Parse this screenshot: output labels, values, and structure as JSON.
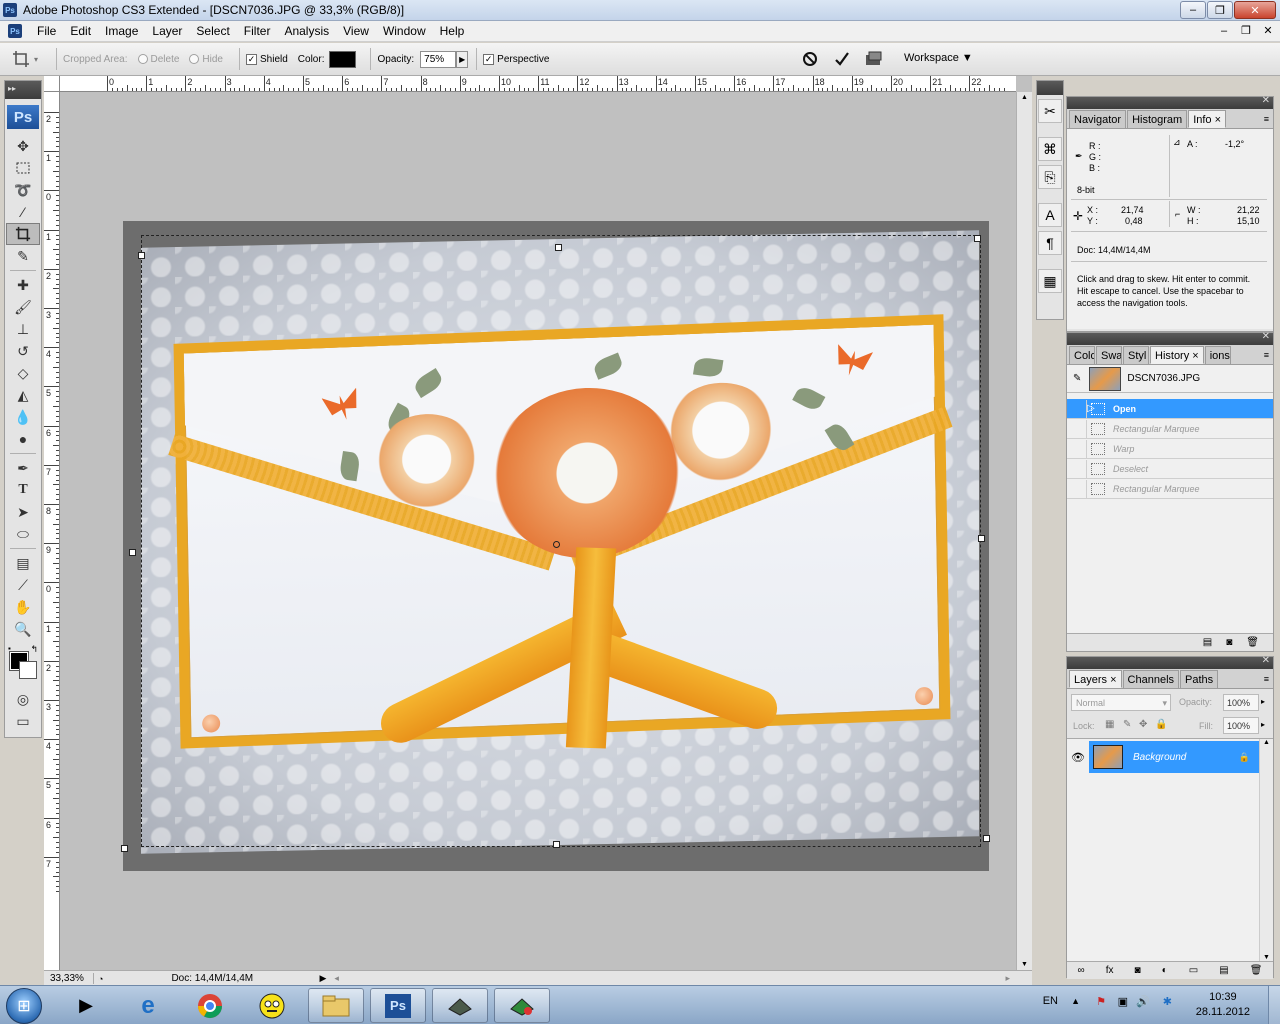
{
  "window": {
    "title": "Adobe Photoshop CS3 Extended - [DSCN7036.JPG @ 33,3% (RGB/8)]",
    "app_icon": "Ps",
    "minimize": "–",
    "restore": "❐",
    "close": "✕"
  },
  "menu": {
    "items": [
      "File",
      "Edit",
      "Image",
      "Layer",
      "Select",
      "Filter",
      "Analysis",
      "View",
      "Window",
      "Help"
    ]
  },
  "options": {
    "cropped_area_label": "Cropped Area:",
    "delete_label": "Delete",
    "hide_label": "Hide",
    "shield_label": "Shield",
    "shield_checked": "✓",
    "color_label": "Color:",
    "shield_color": "#000000",
    "opacity_label": "Opacity:",
    "opacity_value": "75%",
    "perspective_label": "Perspective",
    "perspective_checked": "✓",
    "workspace_label": "Workspace"
  },
  "toolbox": {
    "logo": "Ps"
  },
  "rulers": {
    "top": [
      "0",
      "1",
      "2",
      "3",
      "4",
      "5",
      "6",
      "7",
      "8",
      "9",
      "10",
      "11",
      "12",
      "13",
      "14",
      "15",
      "16",
      "17",
      "18",
      "19",
      "20",
      "21",
      "22"
    ],
    "left": [
      "2",
      "1",
      "0",
      "1",
      "2",
      "3",
      "4",
      "5",
      "6",
      "7",
      "8",
      "9",
      "0",
      "1",
      "2",
      "3",
      "4",
      "5",
      "6",
      "7"
    ]
  },
  "status": {
    "zoom": "33,33%",
    "doc": "Doc: 14,4M/14,4M"
  },
  "info_panel": {
    "tabs": [
      "Navigator",
      "Histogram",
      "Info"
    ],
    "active_tab": "Info",
    "r": "R :",
    "g": "G :",
    "b": "B :",
    "angle_label": "A :",
    "angle_value": "-1,2°",
    "bitdepth": "8-bit",
    "x_label": "X :",
    "x_value": "21,74",
    "y_label": "Y :",
    "y_value": "0,48",
    "w_label": "W :",
    "w_value": "21,22",
    "h_label": "H :",
    "h_value": "15,10",
    "doc": "Doc: 14,4M/14,4M",
    "hint": "Click and drag to skew. Hit enter to commit. Hit escape to cancel. Use the spacebar to access the navigation tools."
  },
  "history_panel": {
    "tabs": [
      "Colo",
      "Swa",
      "Styl",
      "History",
      "ions"
    ],
    "snapshot": "DSCN7036.JPG",
    "steps": [
      {
        "label": "Open",
        "state": "selected"
      },
      {
        "label": "Rectangular Marquee",
        "state": "disabled"
      },
      {
        "label": "Warp",
        "state": "disabled"
      },
      {
        "label": "Deselect",
        "state": "disabled"
      },
      {
        "label": "Rectangular Marquee",
        "state": "disabled"
      }
    ]
  },
  "layers_panel": {
    "tabs": [
      "Layers",
      "Channels",
      "Paths"
    ],
    "blend_mode": "Normal",
    "opacity_label": "Opacity:",
    "opacity_value": "100%",
    "lock_label": "Lock:",
    "fill_label": "Fill:",
    "fill_value": "100%",
    "layer_name": "Background"
  },
  "taskbar": {
    "language": "EN",
    "time": "10:39",
    "date": "28.11.2012"
  },
  "colors": {
    "selection_blue": "#3399ff",
    "ribbon_orange": "#e9a724"
  }
}
